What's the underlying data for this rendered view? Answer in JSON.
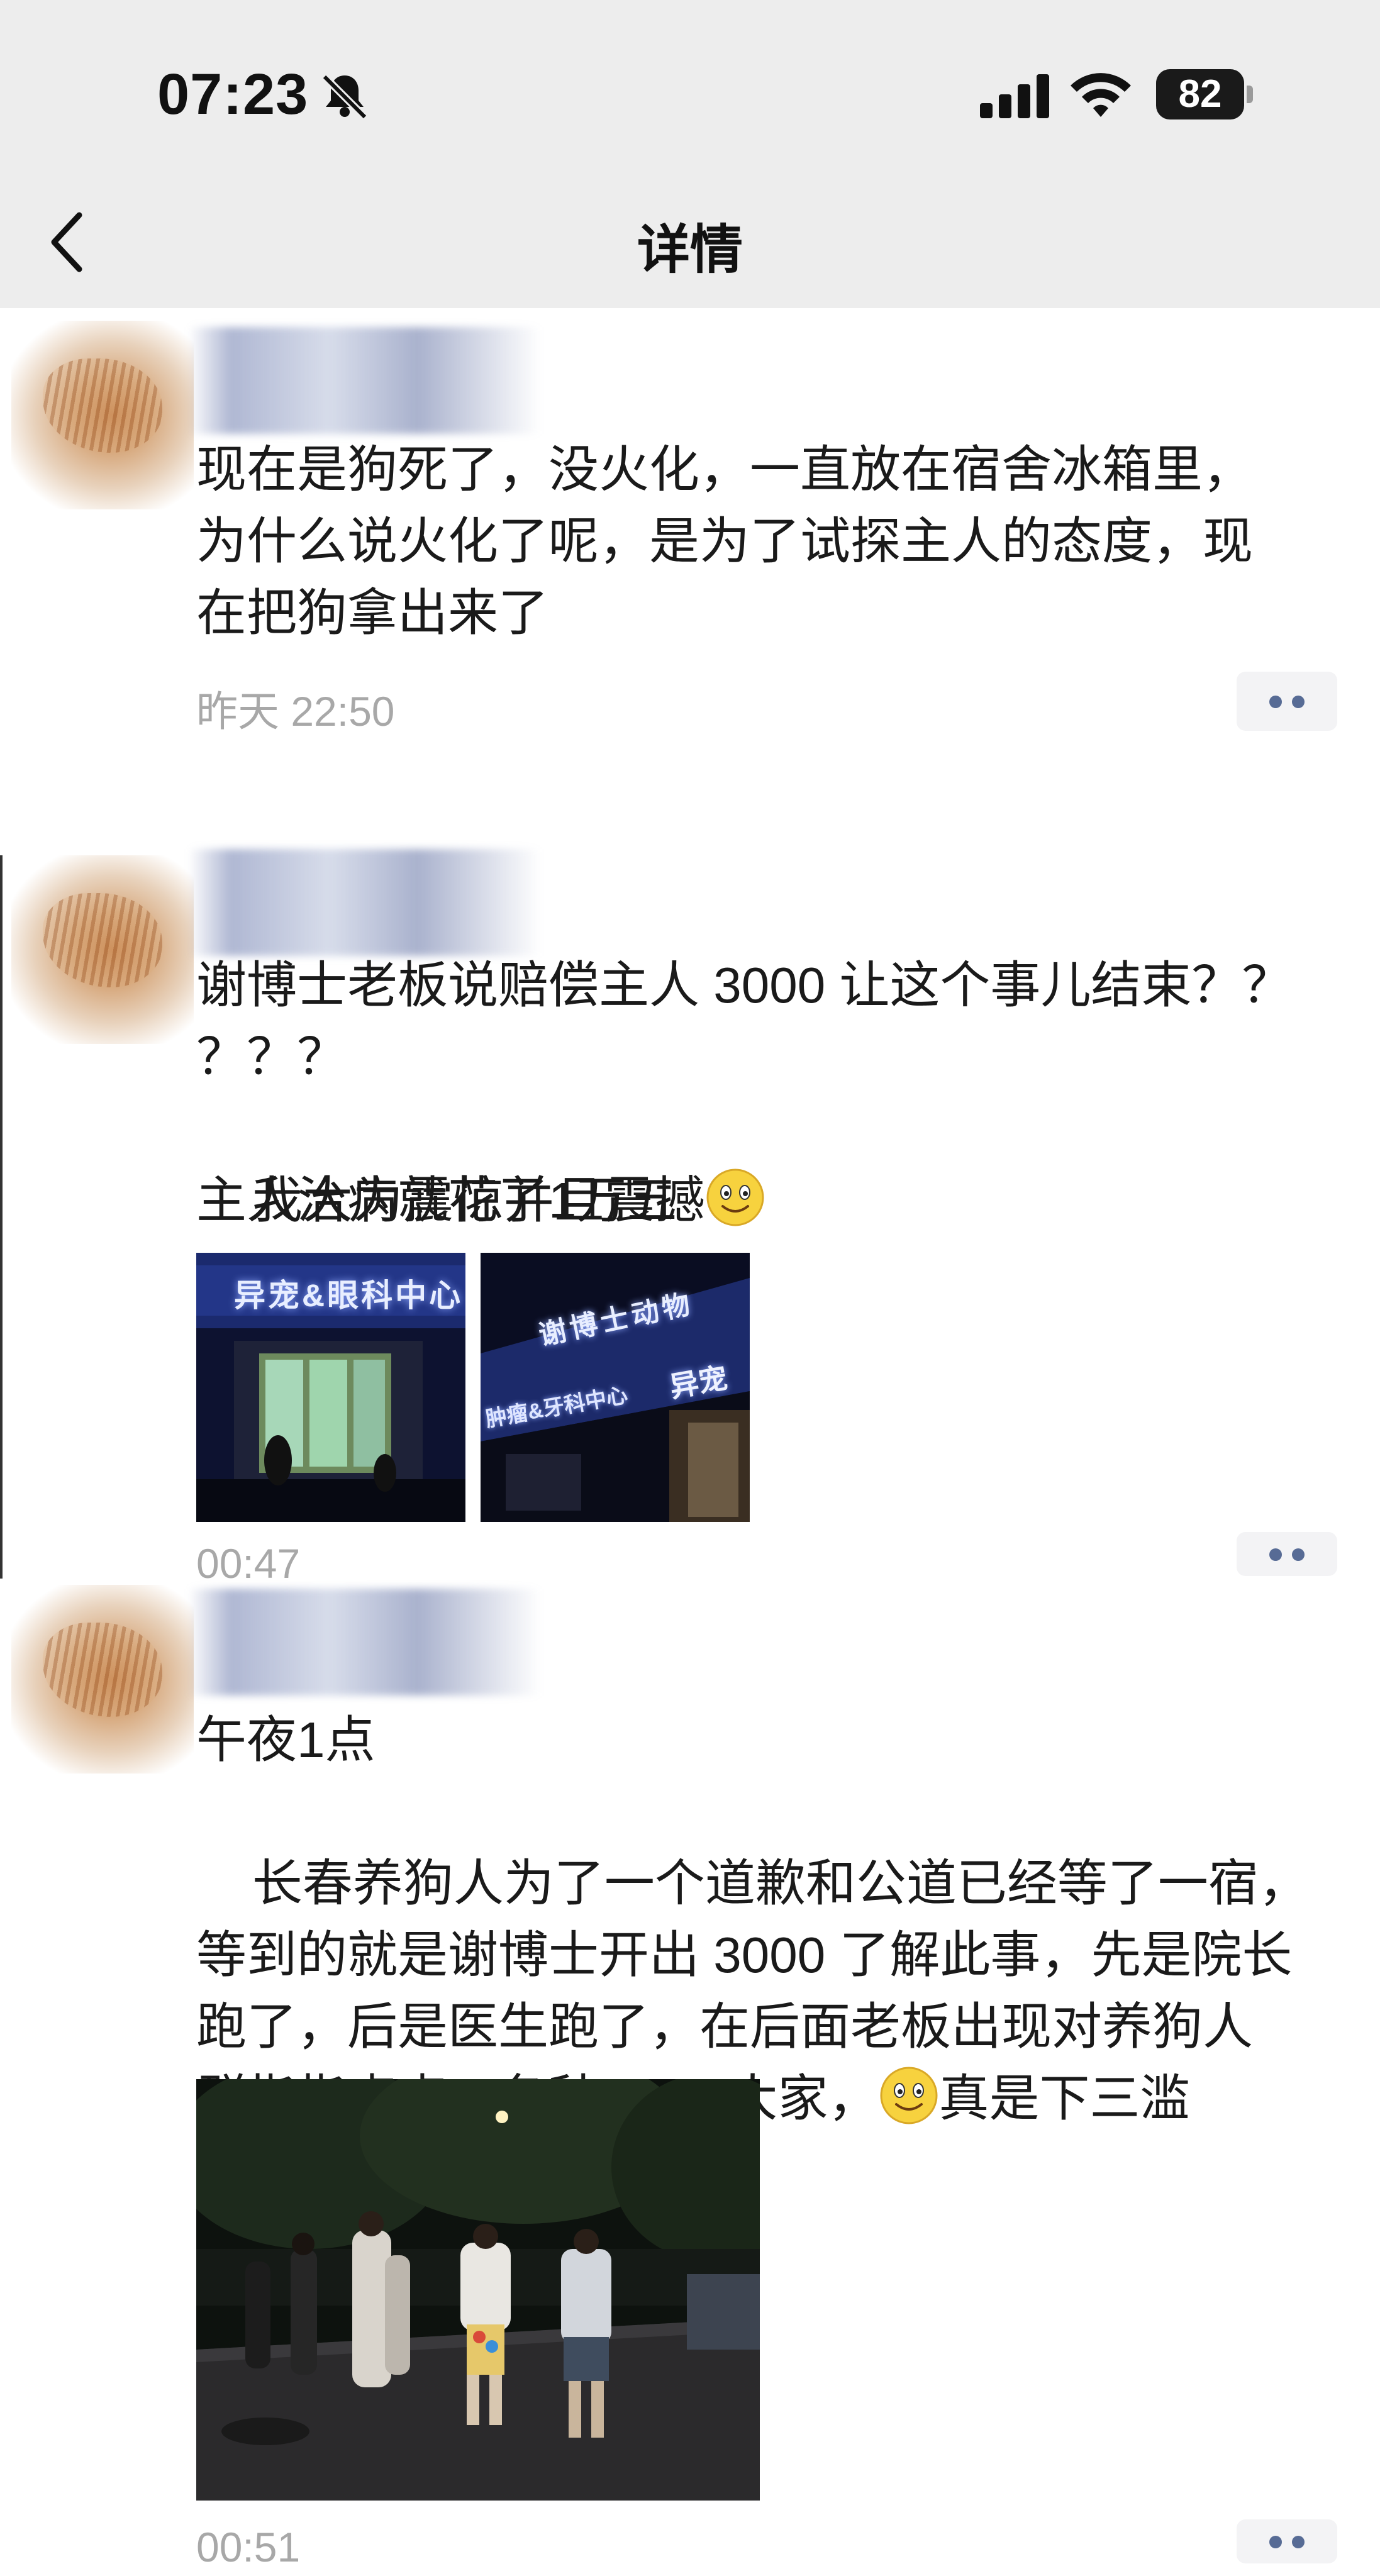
{
  "status_bar": {
    "time": "07:23",
    "mute_icon": "bell-slash-icon",
    "signal_icon": "cellular-signal-icon",
    "wifi_icon": "wifi-icon",
    "battery_level": "82"
  },
  "nav": {
    "back_icon": "chevron-left-icon",
    "title": "详情"
  },
  "posts": [
    {
      "text": "现在是狗死了，没火化，一直放在宿舍冰箱里，\n为什么说火化了呢，是为了试探主人的态度，现\n在把狗拿出来了",
      "time": "昨天 22:50",
      "more_icon": "more-dots-icon"
    },
    {
      "text_line1": "谢博士老板说赔偿主人 3000 让这个事儿结束？？\n？？？",
      "text_line2": "我大为震惊并且震撼",
      "text_line3": "主人治病就花了1万五",
      "emoji_icon": "smile-emoji-icon",
      "images": [
        {
          "sign_text": "异宠&眼科中心"
        },
        {
          "sign_text_top": "谢博士动物",
          "sign_text_mid": "异宠",
          "sign_text_low": "肿瘤&牙科中心"
        }
      ],
      "time": "00:47",
      "more_icon": "more-dots-icon"
    },
    {
      "text_line1": "午夜1点",
      "text_block": "长春养狗人为了一个道歉和公道已经等了一宿，\n等到的就是谢博士开出 3000 了解此事，先是院长\n跑了，后是医生跑了，在后面老板出现对养狗人\n群指指点点，各种 PUA 大家，",
      "text_tail": "真是下三滥",
      "emoji_icon": "smile-emoji-icon",
      "images": [
        {
          "scene": "night-street-photo"
        }
      ],
      "time": "00:51",
      "more_icon": "more-dots-icon"
    }
  ],
  "colors": {
    "top_bg": "#ededed",
    "link_blue": "#576b95",
    "timestamp_gray": "#a8a8a8"
  }
}
